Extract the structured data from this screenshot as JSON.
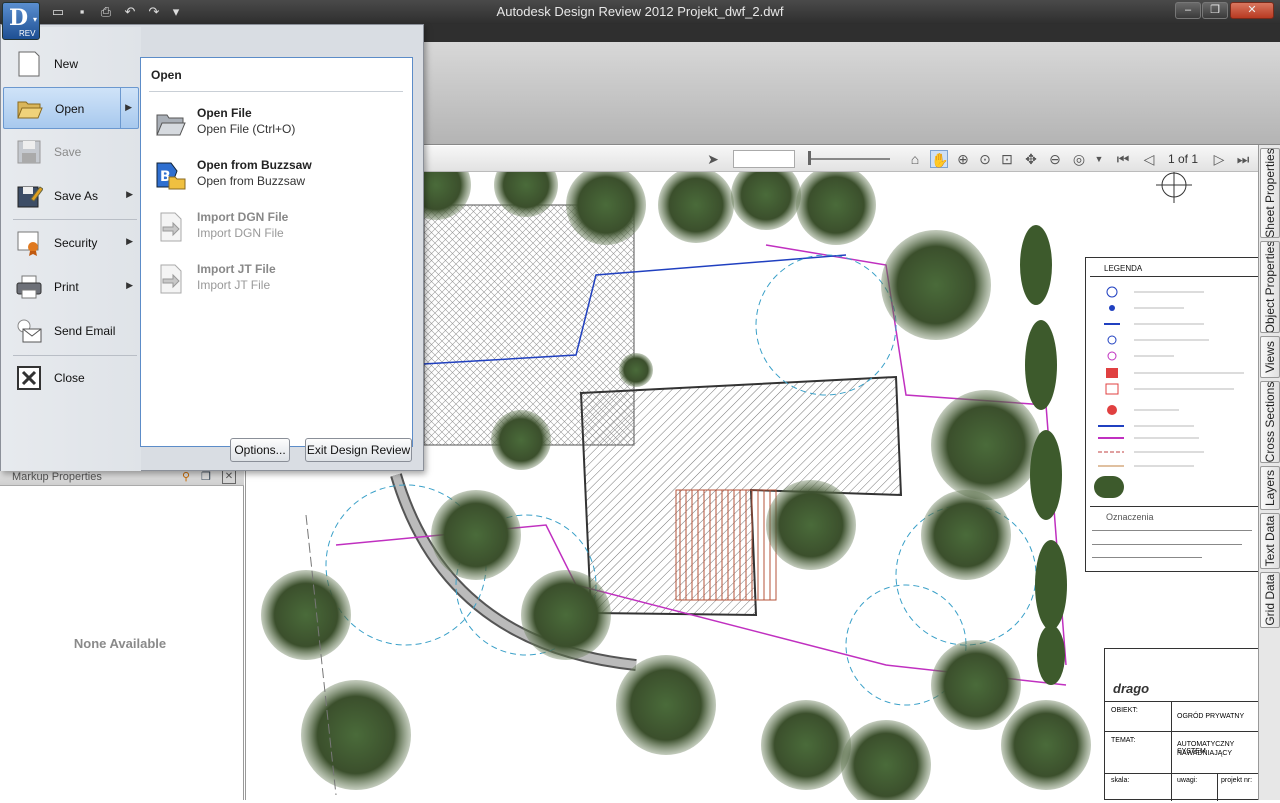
{
  "window": {
    "title": "Autodesk Design Review 2012   Projekt_dwf_2.dwf",
    "app_badge": "REV",
    "controls": [
      "minimize",
      "restore",
      "close"
    ]
  },
  "app_menu": {
    "items": [
      {
        "id": "new",
        "label": "New",
        "icon": "new-document-icon",
        "disabled": false,
        "submenu": false
      },
      {
        "id": "open",
        "label": "Open",
        "icon": "folder-open-icon",
        "disabled": false,
        "submenu": true,
        "active": true
      },
      {
        "id": "save",
        "label": "Save",
        "icon": "save-icon",
        "disabled": true,
        "submenu": false
      },
      {
        "id": "save_as",
        "label": "Save As",
        "icon": "save-as-icon",
        "disabled": false,
        "submenu": true
      },
      {
        "id": "security",
        "label": "Security",
        "icon": "certificate-icon",
        "disabled": false,
        "submenu": true
      },
      {
        "id": "print",
        "label": "Print",
        "icon": "printer-icon",
        "disabled": false,
        "submenu": true
      },
      {
        "id": "send_email",
        "label": "Send Email",
        "icon": "email-icon",
        "disabled": false,
        "submenu": false
      },
      {
        "id": "close",
        "label": "Close",
        "icon": "close-icon",
        "disabled": false,
        "submenu": false
      }
    ],
    "submenu": {
      "heading": "Open",
      "items": [
        {
          "title": "Open File",
          "subtitle": "Open File (Ctrl+O)",
          "icon": "folder-open-icon",
          "disabled": false
        },
        {
          "title": "Open from Buzzsaw",
          "subtitle": "Open from Buzzsaw",
          "icon": "buzzsaw-icon",
          "disabled": false
        },
        {
          "title": "Import DGN File",
          "subtitle": "Import DGN File",
          "icon": "import-file-icon",
          "disabled": true
        },
        {
          "title": "Import JT File",
          "subtitle": "Import JT File",
          "icon": "import-file-icon",
          "disabled": true
        }
      ]
    },
    "footer": {
      "options_label": "Options...",
      "exit_label": "Exit Design Review"
    }
  },
  "viewer_toolbar": {
    "page_info": "1 of 1"
  },
  "left_panel": {
    "header": "Markup Properties",
    "empty_text": "None Available"
  },
  "right_tabs": [
    "Sheet Properties",
    "Object Properties",
    "Views",
    "Cross Sections",
    "Layers",
    "Text Data",
    "Grid Data"
  ],
  "drawing": {
    "legend_title": "LEGENDA",
    "legend_section": "Oznaczenia",
    "logo_text": "drago",
    "label_object": "OBIEKT:",
    "object_value": "OGRÓD PRYWATNY",
    "label_topic": "TEMAT:",
    "topic_value_1": "AUTOMATYCZNY SYSTEM",
    "topic_value_2": "NAWADNIAJĄCY",
    "label_scale": "skala:",
    "label_notes": "uwagi:",
    "label_project": "projekt nr:"
  }
}
